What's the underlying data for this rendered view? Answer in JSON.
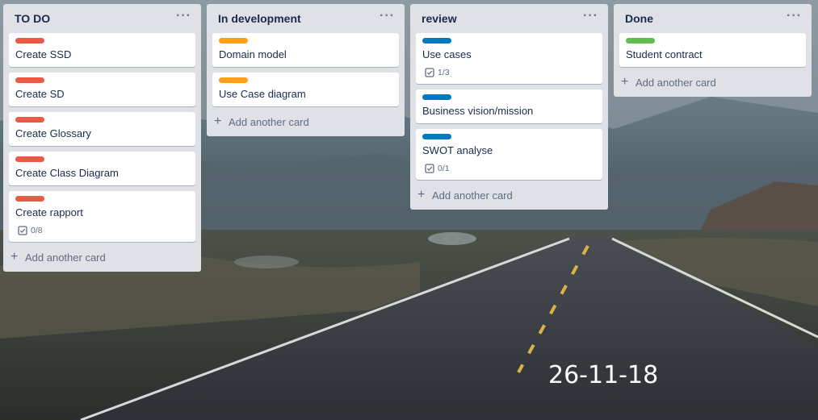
{
  "colors": {
    "red": "#eb5a46",
    "orange": "#ff9f1a",
    "blue": "#0079bf",
    "green": "#61bd4f"
  },
  "icons": {
    "list_menu": "more-horizontal-icon",
    "add": "plus-icon",
    "checklist": "checklist-icon"
  },
  "lists": [
    {
      "title": "TO DO",
      "menu": "···",
      "add_label": "Add another card",
      "cards": [
        {
          "title": "Create SSD",
          "label_color": "red"
        },
        {
          "title": "Create SD",
          "label_color": "red"
        },
        {
          "title": "Create Glossary",
          "label_color": "red"
        },
        {
          "title": "Create Class Diagram",
          "label_color": "red"
        },
        {
          "title": "Create rapport",
          "label_color": "red",
          "checklist": "0/8"
        }
      ]
    },
    {
      "title": "In development",
      "menu": "···",
      "add_label": "Add another card",
      "cards": [
        {
          "title": "Domain model",
          "label_color": "orange"
        },
        {
          "title": "Use Case diagram",
          "label_color": "orange"
        }
      ]
    },
    {
      "title": "review",
      "menu": "···",
      "add_label": "Add another card",
      "cards": [
        {
          "title": "Use cases",
          "label_color": "blue",
          "checklist": "1/3"
        },
        {
          "title": "Business vision/mission",
          "label_color": "blue"
        },
        {
          "title": "SWOT analyse",
          "label_color": "blue",
          "checklist": "0/1"
        }
      ]
    },
    {
      "title": "Done",
      "menu": "···",
      "add_label": "Add another card",
      "cards": [
        {
          "title": "Student contract",
          "label_color": "green"
        }
      ]
    }
  ],
  "date_stamp": "26-11-18"
}
